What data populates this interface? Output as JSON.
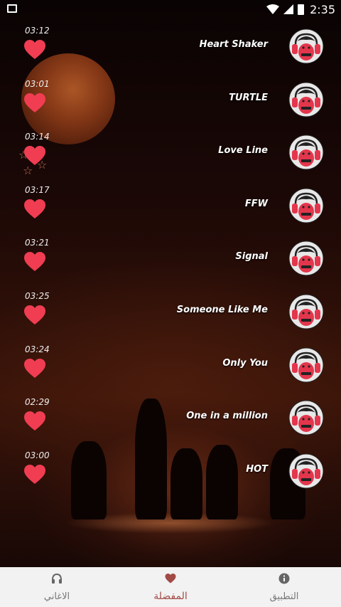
{
  "status_bar": {
    "time": "2:35"
  },
  "songs": [
    {
      "title": "Heart Shaker",
      "duration": "03:12"
    },
    {
      "title": "TURTLE",
      "duration": "03:01"
    },
    {
      "title": "Love Line",
      "duration": "03:14"
    },
    {
      "title": "FFW",
      "duration": "03:17"
    },
    {
      "title": "Signal",
      "duration": "03:21"
    },
    {
      "title": "Someone Like Me",
      "duration": "03:25"
    },
    {
      "title": "Only You",
      "duration": "03:24"
    },
    {
      "title": "One in a million",
      "duration": "02:29"
    },
    {
      "title": "HOT",
      "duration": "03:00"
    }
  ],
  "nav": {
    "songs_label": "الاغاني",
    "favorites_label": "المفضلة",
    "app_label": "التطبيق"
  },
  "colors": {
    "heart": "#f03d52",
    "active_nav": "#a24a45",
    "inactive_nav": "#777777",
    "nav_bg": "#f2f2f2"
  },
  "icons": {
    "song_avatar": "headphone-face-icon",
    "favorite": "heart-icon",
    "songs_tab": "headphones-icon",
    "favorites_tab": "heart-icon",
    "app_tab": "info-icon"
  }
}
